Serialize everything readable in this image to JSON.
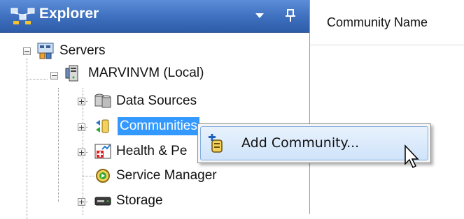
{
  "explorer": {
    "title": "Explorer",
    "dropdown_icon": "chevron-down-icon",
    "pin_icon": "pin-icon"
  },
  "tree": {
    "root": {
      "label": "Servers",
      "icon": "servers-icon",
      "expanded": true
    },
    "server": {
      "label": "MARVINVM (Local)",
      "icon": "server-icon",
      "expanded": true
    },
    "children": [
      {
        "label": "Data Sources",
        "icon": "data-sources-icon",
        "expandable": true
      },
      {
        "label": "Communities",
        "icon": "communities-icon",
        "expandable": true,
        "selected": true
      },
      {
        "label": "Health & Pe",
        "icon": "health-performance-icon",
        "expandable": true
      },
      {
        "label": "Service Manager",
        "icon": "service-manager-icon",
        "expandable": false
      },
      {
        "label": "Storage",
        "icon": "storage-icon",
        "expandable": true
      }
    ]
  },
  "right_panel": {
    "column_header": "Community Name"
  },
  "context_menu": {
    "items": [
      {
        "label": "Add Community...",
        "icon": "add-community-icon",
        "hovered": true
      }
    ]
  },
  "colors": {
    "header_gradient_top": "#5b8dd8",
    "header_gradient_bottom": "#2e5ca8",
    "selection": "#3399ff",
    "menu_hover": "#cfe3fa"
  }
}
